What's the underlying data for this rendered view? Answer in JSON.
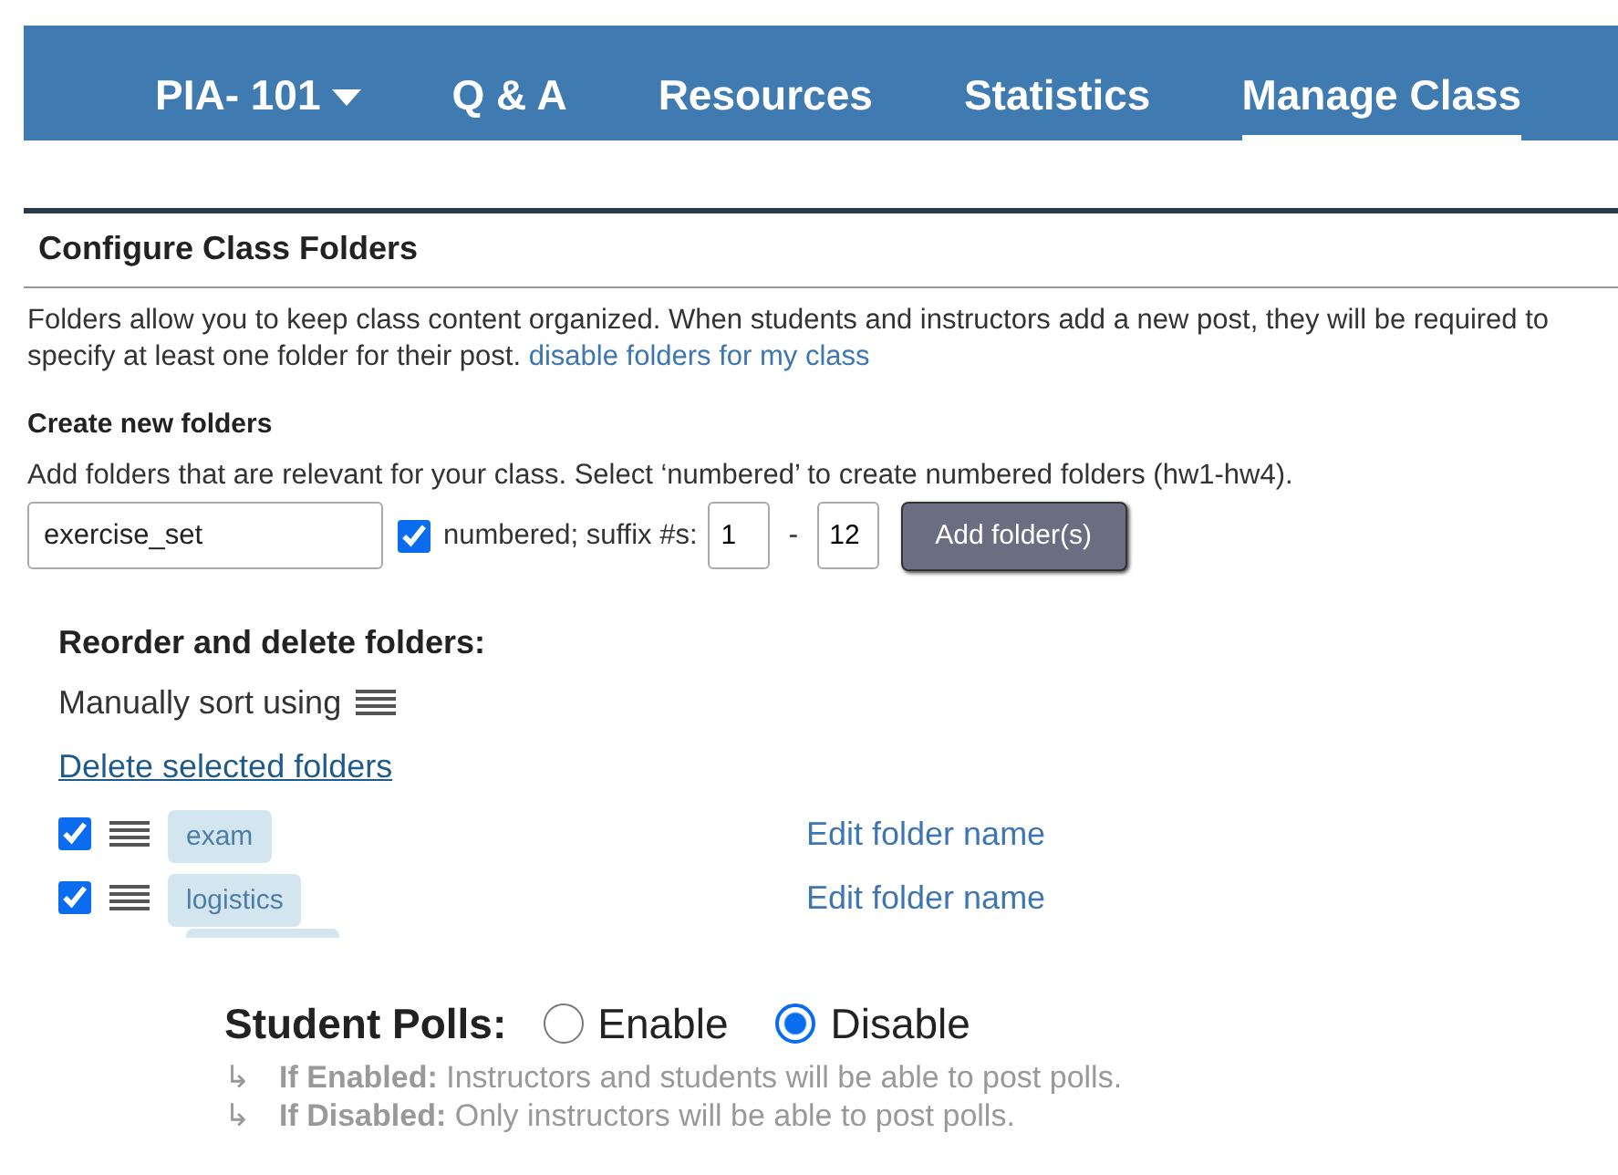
{
  "nav": {
    "items": [
      {
        "label": "PIA- 101",
        "dropdown": true,
        "selected": false
      },
      {
        "label": "Q & A",
        "dropdown": false,
        "selected": false
      },
      {
        "label": "Resources",
        "dropdown": false,
        "selected": false
      },
      {
        "label": "Statistics",
        "dropdown": false,
        "selected": false
      },
      {
        "label": "Manage Class",
        "dropdown": false,
        "selected": true
      }
    ]
  },
  "section_title": "Configure Class Folders",
  "intro": {
    "text": "Folders allow you to keep class content organized. When students and instructors add a new post, they will be required to specify at least one folder for their post.",
    "link": "disable folders for my class"
  },
  "create": {
    "title": "Create new folders",
    "hint": "Add folders that are relevant for your class. Select ‘numbered’ to create numbered folders (hw1-hw4).",
    "name_value": "exercise_set",
    "numbered": true,
    "numbered_label": "numbered; suffix #s:",
    "from": "1",
    "dash": "-",
    "to": "12",
    "button": "Add folder(s)"
  },
  "reorder": {
    "title": "Reorder and delete folders:",
    "sort_hint": "Manually sort using",
    "delete_link": "Delete selected folders",
    "folders": [
      {
        "name": "exam",
        "checked": true,
        "edit": "Edit folder name"
      },
      {
        "name": "logistics",
        "checked": true,
        "edit": "Edit folder name"
      }
    ]
  },
  "polls": {
    "label": "Student Polls:",
    "options": [
      {
        "label": "Enable",
        "selected": false
      },
      {
        "label": "Disable",
        "selected": true
      }
    ],
    "notes": [
      {
        "arrow": "↳",
        "lead": "If Enabled:",
        "text": "Instructors and students will be able to post polls."
      },
      {
        "arrow": "↳",
        "lead": "If Disabled:",
        "text": "Only instructors will be able to post polls."
      }
    ]
  }
}
